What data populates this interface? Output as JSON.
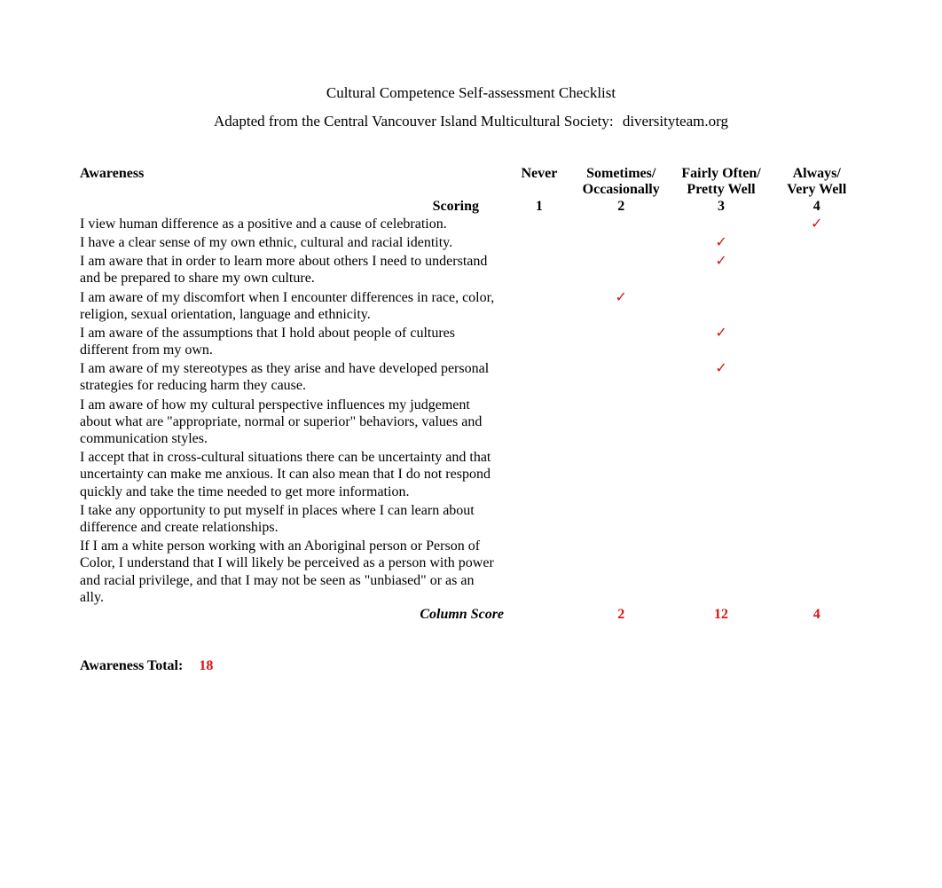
{
  "title": "Cultural Competence Self-assessment Checklist",
  "subtitle_prefix": "Adapted from the Central Vancouver Island Multicultural Society:",
  "subtitle_link": "diversityteam.org",
  "section_header": "Awareness",
  "columns": {
    "scoring_label": "Scoring",
    "c1_line1": "Never",
    "c1_score": "1",
    "c2_line1": "Sometimes/",
    "c2_line2": "Occasionally",
    "c2_score": "2",
    "c3_line1": "Fairly Often/",
    "c3_line2": "Pretty Well",
    "c3_score": "3",
    "c4_line1": "Always/",
    "c4_line2": "Very Well",
    "c4_score": "4"
  },
  "rows": [
    {
      "text": "I view human difference as a positive and a cause of celebration.",
      "mark_col": 4
    },
    {
      "text": "I have a clear sense of my own ethnic, cultural and racial identity.",
      "mark_col": 3
    },
    {
      "text": "I am aware that in order to learn more about others I need to understand and be prepared to share my own culture.",
      "mark_col": 3
    },
    {
      "text": "I am aware of my discomfort when I encounter differences in race, color, religion, sexual orientation, language and ethnicity.",
      "mark_col": 2
    },
    {
      "text": "I am aware of the assumptions that I hold about people of cultures different from my own.",
      "mark_col": 3
    },
    {
      "text": "I am aware of my stereotypes as they arise and have developed personal strategies for reducing harm they cause.",
      "mark_col": 3
    },
    {
      "text": "I am aware of how my cultural perspective influences my judgement about what are \"appropriate, normal or superior\" behaviors, values and communication styles.",
      "mark_col": 0
    },
    {
      "text": "I accept that in cross-cultural situations there can be uncertainty and that uncertainty can make me anxious. It can also mean that I do not respond quickly and take the time needed to get more information.",
      "mark_col": 0
    },
    {
      "text": "I take any opportunity to put myself in places where I can learn about difference and create relationships.",
      "mark_col": 0
    },
    {
      "text": "If I am a white person working with an Aboriginal person or Person of Color, I understand that I will likely be perceived as a person with power and racial privilege, and that I may not be seen as \"unbiased\" or as an ally.",
      "mark_col": 0
    }
  ],
  "subtotal_label": "Column Score",
  "subtotals": {
    "c1": "",
    "c2": "2",
    "c3": "12",
    "c4": "4"
  },
  "total_label": "Awareness Total:",
  "total_value": "18",
  "check_glyph": "✓"
}
